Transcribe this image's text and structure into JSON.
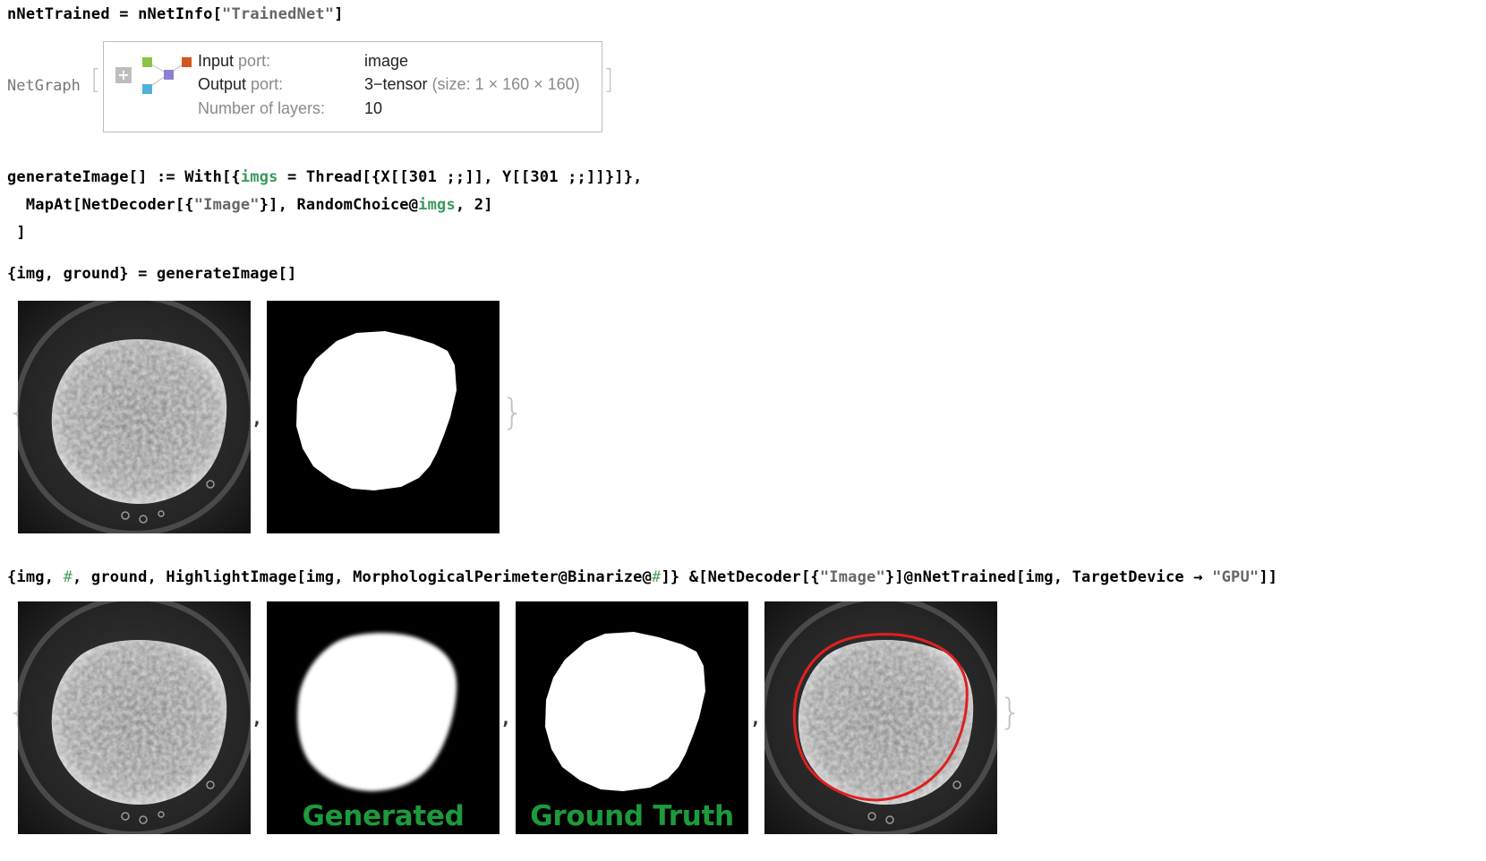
{
  "cell1": {
    "lhs": "nNetTrained",
    "eq": " = ",
    "fn": "nNetInfo",
    "open": "[",
    "arg": "\"TrainedNet\"",
    "close": "]"
  },
  "netgraph": {
    "head": "NetGraph",
    "rows": [
      {
        "key": "Input",
        "key_sub": " port:",
        "value": "image",
        "value_sub": ""
      },
      {
        "key": "Output",
        "key_sub": " port:",
        "value": "3−tensor",
        "value_sub": " (size: 1 × 160 × 160)"
      },
      {
        "key": "",
        "key_sub": "Number of layers:",
        "value": "10",
        "value_sub": ""
      }
    ],
    "node_colors": {
      "input": "#8bc34a",
      "output": "#d2571c",
      "layer": "#8c7fd6",
      "aux": "#4fb3d9"
    }
  },
  "cell2": {
    "line1_a": "generateImage[] := With[{",
    "line1_var": "imgs",
    "line1_b": " = Thread[{X[[301 ;;]], Y[[301 ;;]]}]},",
    "line2_a": "  MapAt[NetDecoder[{",
    "line2_str": "\"Image\"",
    "line2_b": "}], RandomChoice@",
    "line2_var": "imgs",
    "line2_c": ", 2]",
    "line3": " ]"
  },
  "cell3": {
    "code": "{img, ground} = generateImage[]"
  },
  "cell4": {
    "a": "{img, ",
    "slot1": "#",
    "b": ", ground, HighlightImage[img, MorphologicalPerimeter@Binarize@",
    "slot2": "#",
    "c": "]} &[NetDecoder[{",
    "str1": "\"Image\"",
    "d": "}]@nNetTrained[img, TargetDevice → ",
    "str2": "\"GPU\"",
    "e": "]]"
  },
  "output": {
    "open_brace": "{",
    "close_brace": "}",
    "comma": ","
  },
  "captions": {
    "generated": "Generated",
    "ground_truth": "Ground Truth"
  },
  "colors": {
    "caption_green": "#1d9a3c",
    "highlight_red": "#e02020"
  }
}
